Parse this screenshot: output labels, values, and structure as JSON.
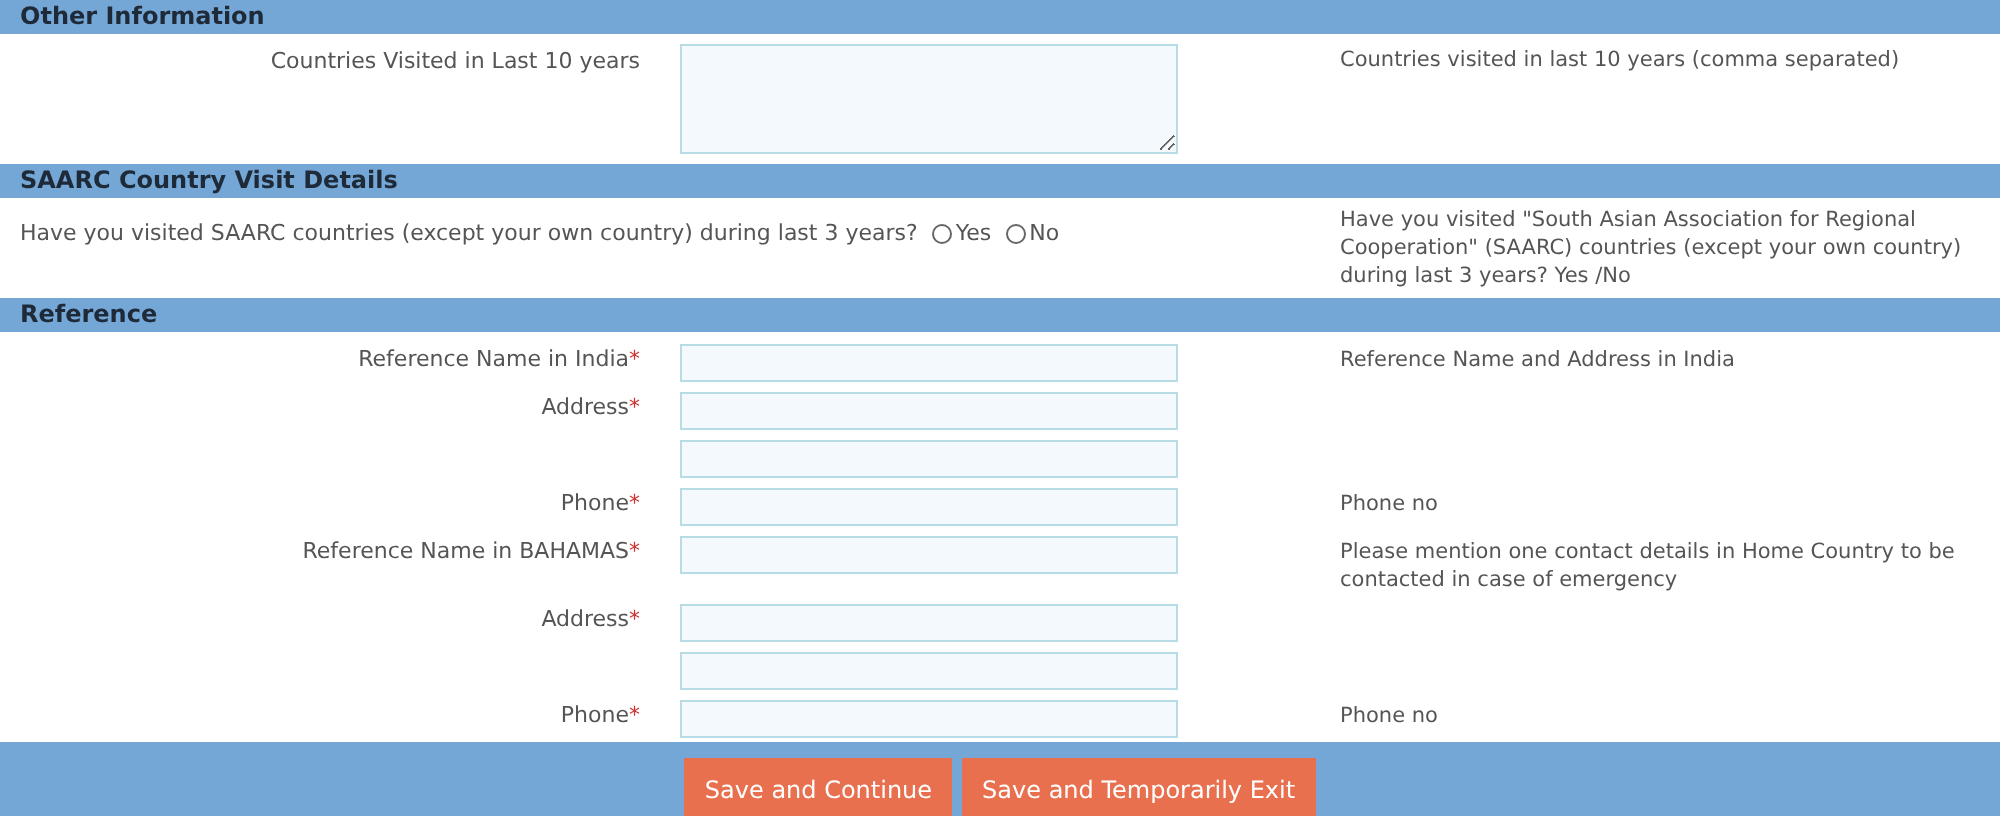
{
  "sections": [
    {
      "title": "Other Information",
      "kind": "fields",
      "rows": [
        {
          "label": "Countries Visited in Last 10 years",
          "kind": "textarea",
          "help": "Countries visited in last 10 years (comma separated)"
        }
      ]
    },
    {
      "title": "SAARC Country Visit Details",
      "kind": "question",
      "question": "Have you visited SAARC countries (except your own country) during last 3 years?",
      "options": [
        {
          "label": "Yes",
          "selected": false
        },
        {
          "label": "No",
          "selected": false
        }
      ],
      "help": "Have you visited \"South Asian Association for Regional Cooperation\" (SAARC) countries (except your own country) during last 3 years? Yes /No"
    },
    {
      "title": "Reference",
      "kind": "fields",
      "rows": [
        {
          "label": "Reference Name in India",
          "mark": "*",
          "kind": "input",
          "help": "Reference Name and Address in India"
        },
        {
          "label": "Address",
          "mark": "*",
          "kind": "input"
        },
        {
          "kind": "input"
        },
        {
          "label": "Phone",
          "mark": "*",
          "kind": "input",
          "help": "Phone no"
        },
        {
          "label": "Reference Name in BAHAMAS",
          "mark": "*",
          "kind": "input",
          "help": "Please mention one contact details in Home Country to be contacted in case of emergency"
        },
        {
          "label": "Address",
          "mark": "*",
          "kind": "input"
        },
        {
          "kind": "input"
        },
        {
          "label": "Phone",
          "mark": "*",
          "kind": "input",
          "help": "Phone no"
        }
      ]
    }
  ],
  "buttons": [
    "Save and Continue",
    "Save and Temporarily Exit"
  ]
}
